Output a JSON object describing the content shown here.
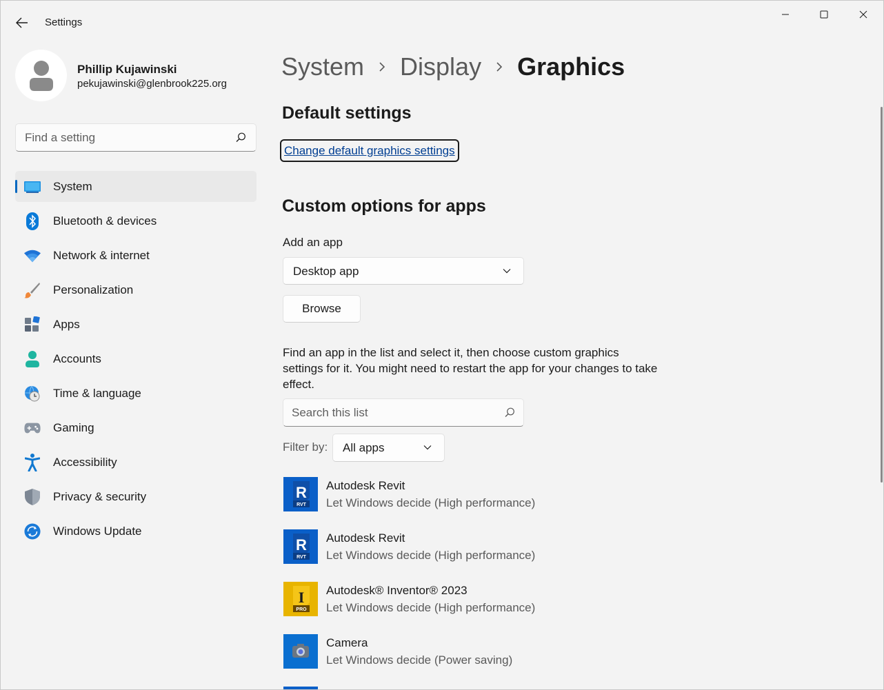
{
  "window": {
    "title": "Settings"
  },
  "profile": {
    "name": "Phillip Kujawinski",
    "email": "pekujawinski@glenbrook225.org"
  },
  "sidebar": {
    "search_placeholder": "Find a setting",
    "items": [
      {
        "label": "System",
        "icon": "system-icon",
        "selected": true
      },
      {
        "label": "Bluetooth & devices",
        "icon": "bluetooth-icon"
      },
      {
        "label": "Network & internet",
        "icon": "wifi-icon"
      },
      {
        "label": "Personalization",
        "icon": "brush-icon"
      },
      {
        "label": "Apps",
        "icon": "apps-icon"
      },
      {
        "label": "Accounts",
        "icon": "person-icon"
      },
      {
        "label": "Time & language",
        "icon": "globe-clock-icon"
      },
      {
        "label": "Gaming",
        "icon": "gamepad-icon"
      },
      {
        "label": "Accessibility",
        "icon": "accessibility-icon"
      },
      {
        "label": "Privacy & security",
        "icon": "shield-icon"
      },
      {
        "label": "Windows Update",
        "icon": "update-icon"
      }
    ]
  },
  "breadcrumb": [
    "System",
    "Display",
    "Graphics"
  ],
  "main": {
    "default_heading": "Default settings",
    "change_link": "Change default graphics settings",
    "custom_heading": "Custom options for apps",
    "add_app_label": "Add an app",
    "app_type_selected": "Desktop app",
    "browse_label": "Browse",
    "description": "Find an app in the list and select it, then choose custom graphics settings for it. You might need to restart the app for your changes to take effect.",
    "search_placeholder": "Search this list",
    "filter_label": "Filter by:",
    "filter_selected": "All apps",
    "apps": [
      {
        "name": "Autodesk Revit",
        "pref": "Let Windows decide (High performance)",
        "icon": "revit-icon",
        "letter": "R",
        "sub": "RVT",
        "color": "#0a5fc8"
      },
      {
        "name": "Autodesk Revit",
        "pref": "Let Windows decide (High performance)",
        "icon": "revit-icon",
        "letter": "R",
        "sub": "RVT",
        "color": "#0a5fc8"
      },
      {
        "name": "Autodesk® Inventor® 2023",
        "pref": "Let Windows decide (High performance)",
        "icon": "inventor-icon",
        "letter": "I",
        "sub": "PRO",
        "color": "#e8b400"
      },
      {
        "name": "Camera",
        "pref": "Let Windows decide (Power saving)",
        "icon": "camera-icon",
        "color": "#0a6fd0"
      }
    ]
  },
  "colors": {
    "accent": "#0067c0",
    "link": "#003e92",
    "revit": "#0a5fc8",
    "inventor": "#e8b400"
  }
}
